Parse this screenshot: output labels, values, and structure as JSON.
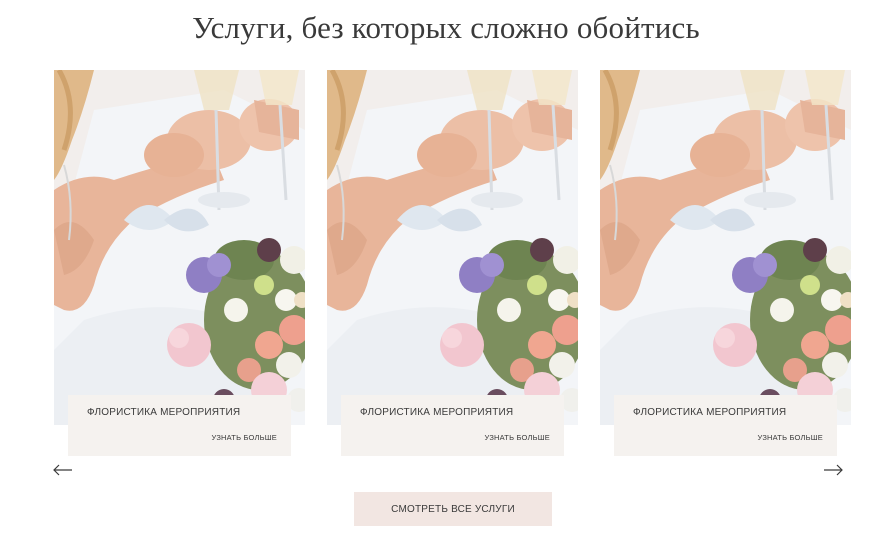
{
  "section": {
    "title": "Услуги, без которых сложно обойтись"
  },
  "cards": [
    {
      "title": "ФЛОРИСТИКА МЕРОПРИЯТИЯ",
      "link": "УЗНАТЬ БОЛЬШЕ",
      "image": "wedding-bride-bouquet-champagne-photo"
    },
    {
      "title": "ФЛОРИСТИКА МЕРОПРИЯТИЯ",
      "link": "УЗНАТЬ БОЛЬШЕ",
      "image": "wedding-bride-bouquet-champagne-photo"
    },
    {
      "title": "ФЛОРИСТИКА МЕРОПРИЯТИЯ",
      "link": "УЗНАТЬ БОЛЬШЕ",
      "image": "wedding-bride-bouquet-champagne-photo"
    }
  ],
  "nav": {
    "prev_icon": "arrow-left-icon",
    "next_icon": "arrow-right-icon"
  },
  "cta": {
    "label": "СМОТРЕТЬ ВСЕ УСЛУГИ"
  },
  "colors": {
    "caption_bg": "#f5f2ef",
    "button_bg": "#f2e6e2",
    "text": "#3a3a3a"
  }
}
